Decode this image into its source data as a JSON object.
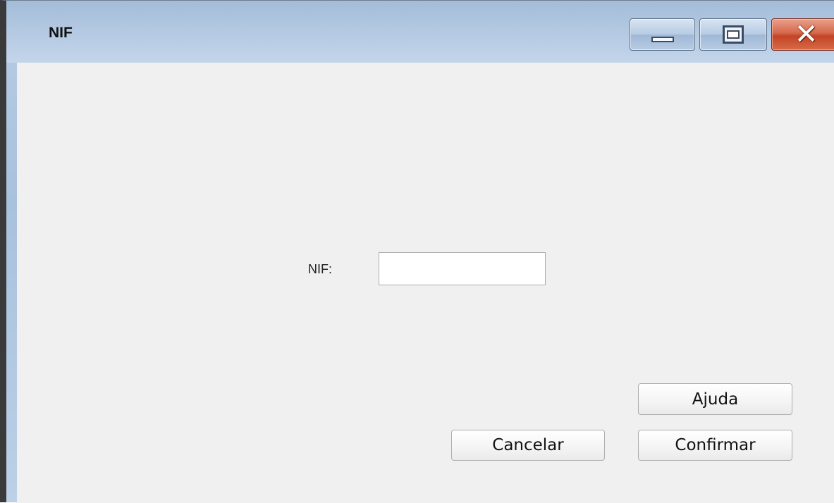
{
  "window": {
    "title": "NIF"
  },
  "caption_buttons": {
    "minimize_icon": "minimize-icon",
    "maximize_icon": "maximize-icon",
    "close_icon": "close-icon",
    "close_glyph": "✕"
  },
  "form": {
    "nif_label": "NIF:",
    "nif_value": "",
    "nif_placeholder": ""
  },
  "buttons": {
    "help": "Ajuda",
    "cancel": "Cancelar",
    "confirm": "Confirmar"
  },
  "colors": {
    "titlebar": "#b4c9e2",
    "client_background": "#f0f0f0",
    "close_button": "#c44427"
  }
}
